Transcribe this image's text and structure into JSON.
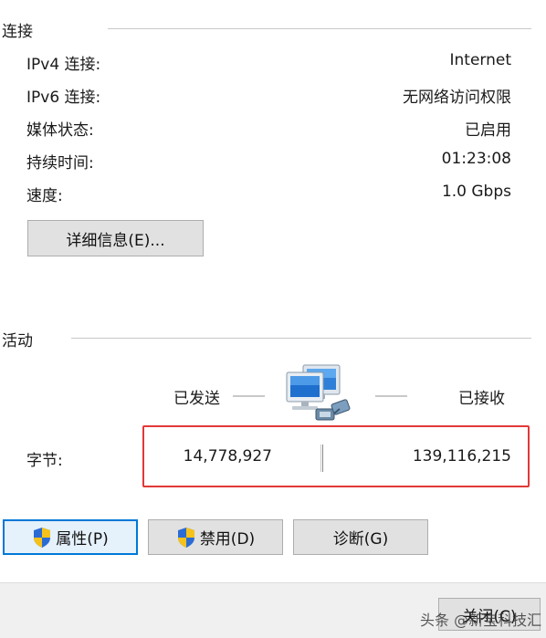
{
  "connection": {
    "title": "连接",
    "rows": [
      {
        "label": "IPv4 连接:",
        "value": "Internet"
      },
      {
        "label": "IPv6 连接:",
        "value": "无网络访问权限"
      },
      {
        "label": "媒体状态:",
        "value": "已启用"
      },
      {
        "label": "持续时间:",
        "value": "01:23:08"
      },
      {
        "label": "速度:",
        "value": "1.0 Gbps"
      }
    ],
    "details_button": "详细信息(E)..."
  },
  "activity": {
    "title": "活动",
    "sent_label": "已发送",
    "received_label": "已接收",
    "bytes_label": "字节:",
    "bytes_sent": "14,778,927",
    "bytes_received": "139,116,215"
  },
  "buttons": {
    "properties": "属性(P)",
    "disable": "禁用(D)",
    "diagnose": "诊断(G)",
    "close": "关闭(C)"
  },
  "watermark": "头条 @新宝科技汇",
  "colors": {
    "highlight_box": "#e23838",
    "focus_border": "#0078d7"
  }
}
